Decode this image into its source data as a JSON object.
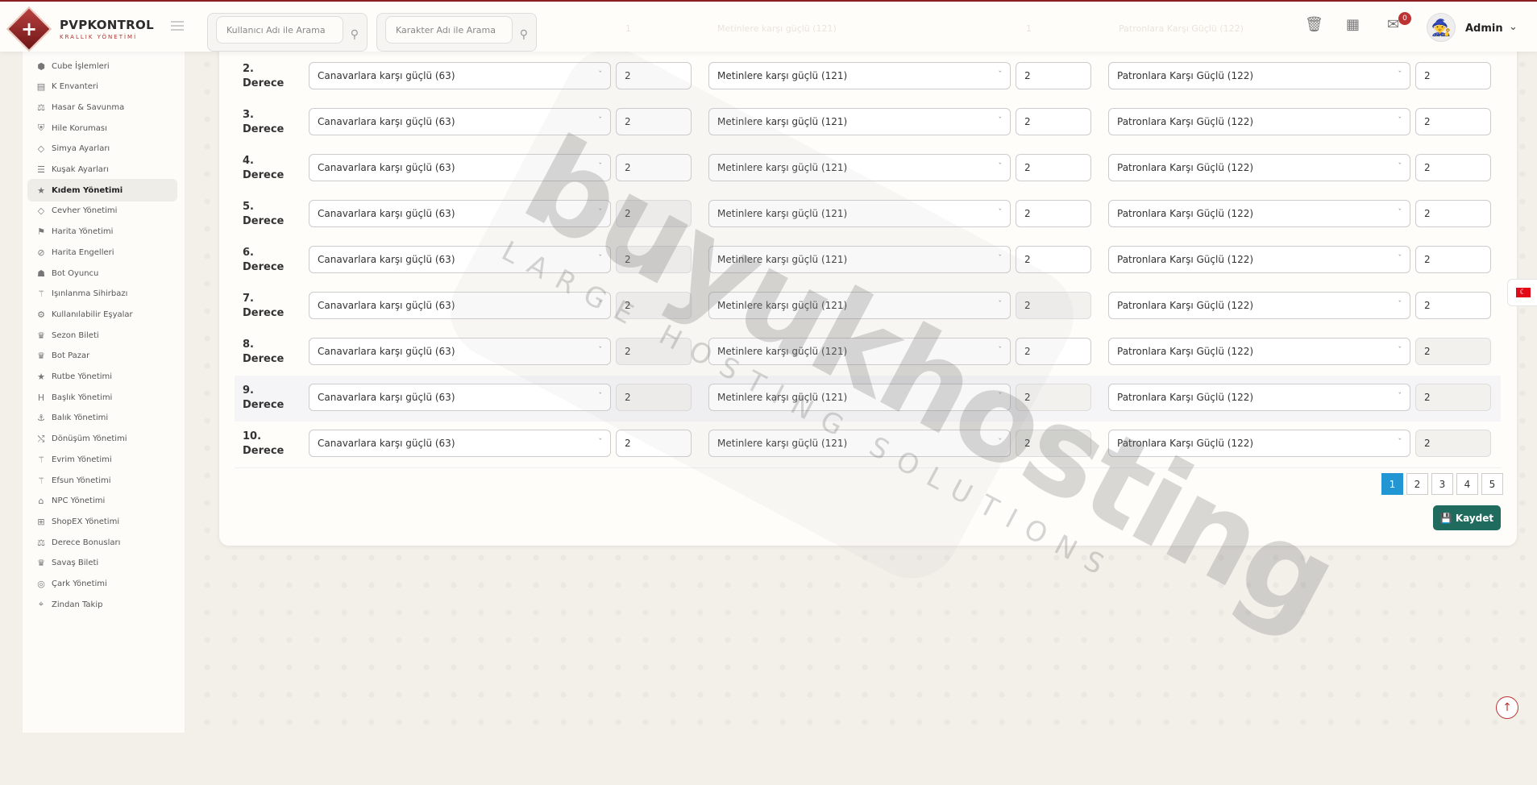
{
  "brand": {
    "title": "PVPKONTROL",
    "subtitle": "KRALLIK YÖNETİMİ"
  },
  "header": {
    "search_user_placeholder": "Kullanıcı Adı ile Arama",
    "search_char_placeholder": "Karakter Adı ile Arama",
    "notification_count": "0",
    "admin_name": "Admin",
    "partial_text_1": "1",
    "partial_text_2": "Metinlere karşı güçlü (121)",
    "partial_text_3": "1",
    "partial_text_4": "Patronlara Karşı Güçlü (122)"
  },
  "sidebar": {
    "items": [
      {
        "label": "Cube İşlemleri",
        "icon": "cube-icon"
      },
      {
        "label": "K Envanteri",
        "icon": "grid-icon"
      },
      {
        "label": "Hasar & Savunma",
        "icon": "scale-icon"
      },
      {
        "label": "Hile Koruması",
        "icon": "shield-icon"
      },
      {
        "label": "Simya Ayarları",
        "icon": "gem-icon"
      },
      {
        "label": "Kuşak Ayarları",
        "icon": "sliders-icon"
      },
      {
        "label": "Kıdem Yönetimi",
        "icon": "star-icon"
      },
      {
        "label": "Cevher Yönetimi",
        "icon": "gem-icon"
      },
      {
        "label": "Harita Yönetimi",
        "icon": "map-icon"
      },
      {
        "label": "Harita Engelleri",
        "icon": "ban-icon"
      },
      {
        "label": "Bot Oyuncu",
        "icon": "robot-icon"
      },
      {
        "label": "Işınlanma Sihirbazı",
        "icon": "wand-icon"
      },
      {
        "label": "Kullanılabilir Eşyalar",
        "icon": "cogs-icon"
      },
      {
        "label": "Sezon Bileti",
        "icon": "trophy-icon"
      },
      {
        "label": "Bot Pazar",
        "icon": "trophy-icon"
      },
      {
        "label": "Rutbe Yönetimi",
        "icon": "star-icon"
      },
      {
        "label": "Başlık Yönetimi",
        "icon": "heading-icon"
      },
      {
        "label": "Balık Yönetimi",
        "icon": "anchor-icon"
      },
      {
        "label": "Dönüşüm Yönetimi",
        "icon": "shuffle-icon"
      },
      {
        "label": "Evrim Yönetimi",
        "icon": "wand-icon"
      },
      {
        "label": "Efsun Yönetimi",
        "icon": "wand-icon"
      },
      {
        "label": "NPC Yönetimi",
        "icon": "bank-icon"
      },
      {
        "label": "ShopEX Yönetimi",
        "icon": "shop-icon"
      },
      {
        "label": "Derece Bonusları",
        "icon": "scale-icon"
      },
      {
        "label": "Savaş Bileti",
        "icon": "trophy-icon"
      },
      {
        "label": "Çark Yönetimi",
        "icon": "globe-icon"
      },
      {
        "label": "Zindan Takip",
        "icon": "pin-icon"
      }
    ]
  },
  "rows": [
    {
      "label": "2.\nDerece",
      "s1": "Canavarlara karşı güçlü (63)",
      "v1": "2",
      "s2": "Metinlere karşı güçlü (121)",
      "v2": "2",
      "s3": "Patronlara Karşı Güçlü (122)",
      "v3": "2"
    },
    {
      "label": "3.\nDerece",
      "s1": "Canavarlara karşı güçlü (63)",
      "v1": "2",
      "s2": "Metinlere karşı güçlü (121)",
      "v2": "2",
      "s3": "Patronlara Karşı Güçlü (122)",
      "v3": "2"
    },
    {
      "label": "4.\nDerece",
      "s1": "Canavarlara karşı güçlü (63)",
      "v1": "2",
      "s2": "Metinlere karşı güçlü (121)",
      "v2": "2",
      "s3": "Patronlara Karşı Güçlü (122)",
      "v3": "2"
    },
    {
      "label": "5.\nDerece",
      "s1": "Canavarlara karşı güçlü (63)",
      "v1": "2",
      "s2": "Metinlere karşı güçlü (121)",
      "v2": "2",
      "s3": "Patronlara Karşı Güçlü (122)",
      "v3": "2"
    },
    {
      "label": "6.\nDerece",
      "s1": "Canavarlara karşı güçlü (63)",
      "v1": "2",
      "s2": "Metinlere karşı güçlü (121)",
      "v2": "2",
      "s3": "Patronlara Karşı Güçlü (122)",
      "v3": "2"
    },
    {
      "label": "7.\nDerece",
      "s1": "Canavarlara karşı güçlü (63)",
      "v1": "2",
      "s2": "Metinlere karşı güçlü (121)",
      "v2": "2",
      "s3": "Patronlara Karşı Güçlü (122)",
      "v3": "2"
    },
    {
      "label": "8.\nDerece",
      "s1": "Canavarlara karşı güçlü (63)",
      "v1": "2",
      "s2": "Metinlere karşı güçlü (121)",
      "v2": "2",
      "s3": "Patronlara Karşı Güçlü (122)",
      "v3": "2"
    },
    {
      "label": "9.\nDerece",
      "s1": "Canavarlara karşı güçlü (63)",
      "v1": "2",
      "s2": "Metinlere karşı güçlü (121)",
      "v2": "2",
      "s3": "Patronlara Karşı Güçlü (122)",
      "v3": "2"
    },
    {
      "label": "10.\nDerece",
      "s1": "Canavarlara karşı güçlü (63)",
      "v1": "2",
      "s2": "Metinlere karşı güçlü (121)",
      "v2": "2",
      "s3": "Patronlara Karşı Güçlü (122)",
      "v3": "2"
    }
  ],
  "pagination": {
    "pages": [
      "1",
      "2",
      "3",
      "4",
      "5"
    ],
    "current": "1"
  },
  "save_label": "Kaydet",
  "watermark": {
    "main": "buyukhosting",
    "sub": "LARGE HOSTING SOLUTIONS"
  },
  "colors": {
    "brand_red": "#8b1e1e",
    "save_green": "#1f6b5e",
    "page_active": "#2196d3"
  }
}
